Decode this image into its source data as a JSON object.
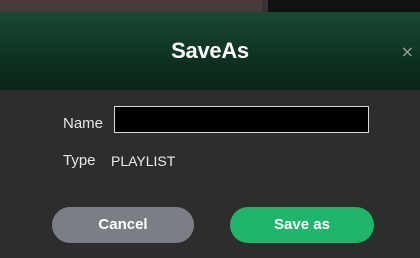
{
  "dialog": {
    "title": "SaveAs",
    "close_symbol": "×",
    "close_icon": "close-icon",
    "name_label": "Name",
    "name_value": "",
    "type_label": "Type",
    "type_value": "PLAYLIST",
    "cancel_label": "Cancel",
    "save_label": "Save as"
  },
  "colors": {
    "header_dark": "#0f3322",
    "body_bg": "#2d2d2d",
    "cancel_bg": "#7a7f86",
    "save_bg": "#1fb56a"
  }
}
